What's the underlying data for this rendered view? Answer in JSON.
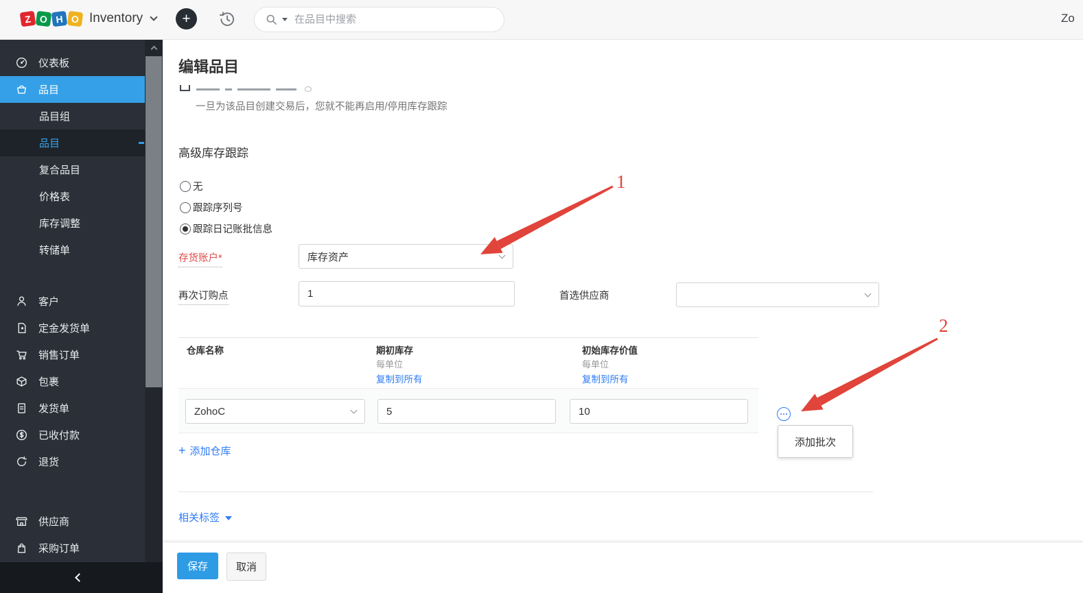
{
  "topbar": {
    "logo_letters": [
      "Z",
      "O",
      "H",
      "O"
    ],
    "product_name": "Inventory",
    "search_placeholder": "在品目中搜索",
    "user_text": "Zo"
  },
  "sidebar": {
    "items": [
      {
        "id": "dashboard",
        "icon": "dashboard-icon",
        "label": "仪表板"
      },
      {
        "id": "items",
        "icon": "items-icon",
        "label": "品目",
        "active": true
      },
      {
        "id": "item-groups",
        "label": "品目组",
        "sub": true
      },
      {
        "id": "items-sub",
        "label": "品目",
        "sub": true,
        "active": true,
        "dash": true
      },
      {
        "id": "composite-items",
        "label": "复合品目",
        "sub": true
      },
      {
        "id": "price-lists",
        "label": "价格表",
        "sub": true
      },
      {
        "id": "inventory-adjustments",
        "label": "库存调整",
        "sub": true
      },
      {
        "id": "transfer-orders",
        "label": "转储单",
        "sub": true
      },
      {
        "type": "gap",
        "size": "a"
      },
      {
        "id": "customers",
        "icon": "customers-icon",
        "label": "客户"
      },
      {
        "id": "retainer-invoices",
        "icon": "retainer-icon",
        "label": "定金发货单"
      },
      {
        "id": "sales-orders",
        "icon": "sales-order-icon",
        "label": "销售订单"
      },
      {
        "id": "packages",
        "icon": "packages-icon",
        "label": "包裹"
      },
      {
        "id": "shipments",
        "icon": "shipment-icon",
        "label": "发货单"
      },
      {
        "id": "payments-received",
        "icon": "payments-icon",
        "label": "已收付款"
      },
      {
        "id": "returns",
        "icon": "returns-icon",
        "label": "退货"
      },
      {
        "type": "gap",
        "size": "b"
      },
      {
        "id": "vendors",
        "icon": "vendors-icon",
        "label": "供应商"
      },
      {
        "id": "purchase-orders",
        "icon": "purchase-order-icon",
        "label": "采购订单"
      }
    ]
  },
  "page": {
    "title": "编辑品目",
    "tracking_note": "一旦为该品目创建交易后，您就不能再启用/停用库存跟踪",
    "section_title": "高级库存跟踪"
  },
  "radios": [
    {
      "label": "无",
      "selected": false
    },
    {
      "label": "跟踪序列号",
      "selected": false
    },
    {
      "label": "跟踪日记账批信息",
      "selected": true
    }
  ],
  "fields": {
    "inventory_account": {
      "label": "存货账户*",
      "value": "库存资产"
    },
    "reorder_point": {
      "label": "再次订购点",
      "value": "1"
    },
    "preferred_vendor": {
      "label": "首选供应商",
      "value": ""
    }
  },
  "warehouse_table": {
    "headers": [
      {
        "title": "仓库名称",
        "sub": "",
        "link": ""
      },
      {
        "title": "期初库存",
        "sub": "每单位",
        "link": "复制到所有"
      },
      {
        "title": "初始库存价值",
        "sub": "每单位",
        "link": "复制到所有"
      }
    ],
    "rows": [
      {
        "warehouse": "ZohoC",
        "opening_stock": "5",
        "opening_value": "10"
      }
    ],
    "add_warehouse_label": "添加仓库",
    "add_warehouse_plus": "+",
    "row_menu": {
      "add_batch_label": "添加批次"
    }
  },
  "related_tags_label": "相关标签",
  "footer": {
    "save_label": "保存",
    "cancel_label": "取消"
  },
  "annotations": {
    "num1": "1",
    "num2": "2"
  },
  "colors": {
    "sidebar_active_blue": "#35a0e8",
    "link_blue": "#2e7cf6",
    "required_red": "#e14c4c",
    "arrow_red": "#e0443a",
    "save_blue": "#2e9be5",
    "logo_red": "#e0262c",
    "logo_green": "#079949",
    "logo_blue": "#2175bc",
    "logo_yellow": "#efb21f"
  }
}
